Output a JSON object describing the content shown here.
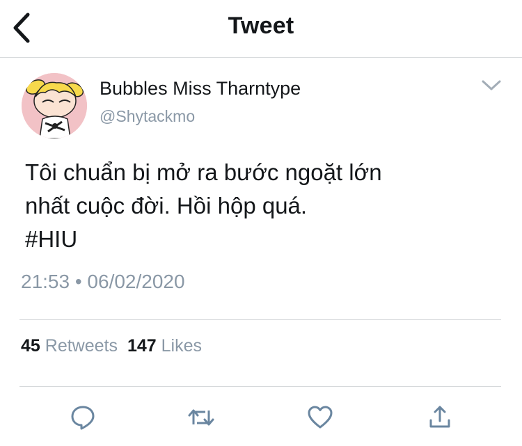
{
  "header": {
    "title": "Tweet",
    "back_icon": "chevron-left-icon"
  },
  "author": {
    "display_name": "Bubbles Miss Tharntype",
    "handle": "@Shytackmo",
    "avatar_icon": "avatar-bubbles-image"
  },
  "tweet": {
    "lines": [
      "Tôi chuẩn bị mở ra bước ngoặt lớn",
      "nhất cuộc đời. Hồi hộp quá.",
      "#HIU"
    ],
    "timestamp": "21:53 • 06/02/2020"
  },
  "stats": {
    "retweets_count": "45",
    "retweets_label": "Retweets",
    "likes_count": "147",
    "likes_label": "Likes"
  },
  "actions": [
    {
      "name": "reply",
      "icon": "reply-icon"
    },
    {
      "name": "retweet",
      "icon": "retweet-icon"
    },
    {
      "name": "like",
      "icon": "heart-icon"
    },
    {
      "name": "share",
      "icon": "share-icon"
    }
  ],
  "colors": {
    "text": "#14171a",
    "secondary": "#8a98a6",
    "divider": "#d6d9db",
    "action_icon": "#6a86a0"
  }
}
